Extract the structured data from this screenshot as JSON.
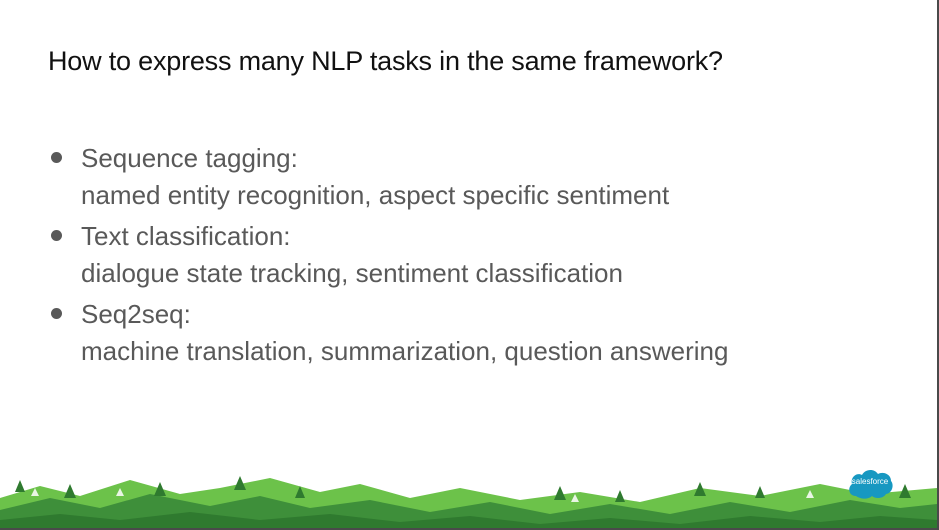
{
  "slide": {
    "title": "How to express many NLP tasks in the same framework?",
    "bullets": [
      {
        "heading": "Sequence tagging:",
        "detail": "named entity recognition, aspect specific sentiment"
      },
      {
        "heading": "Text classification:",
        "detail": "dialogue state tracking, sentiment classification"
      },
      {
        "heading": "Seq2seq:",
        "detail": "machine translation, summarization, question answering"
      }
    ]
  },
  "footer": {
    "logo_text": "salesforce",
    "icon": "salesforce-cloud-icon"
  },
  "colors": {
    "title": "#111111",
    "bullet_text": "#595959",
    "hill_light": "#6cc24a",
    "hill_dark": "#3e8f3a",
    "tree": "#2f7a2f",
    "logo_blue": "#1798c1"
  }
}
